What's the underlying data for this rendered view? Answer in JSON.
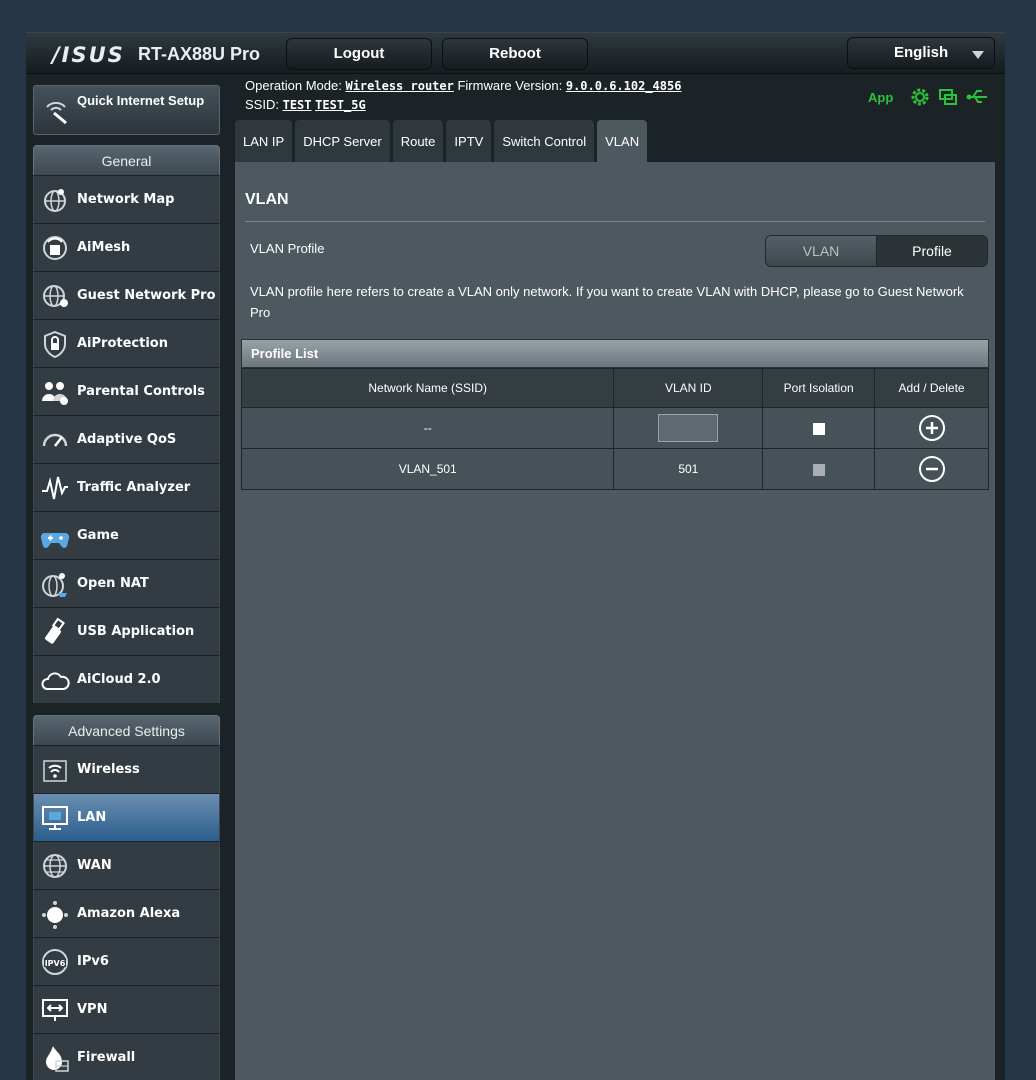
{
  "header": {
    "logo": "/ISUS",
    "model": "RT-AX88U Pro",
    "logout_label": "Logout",
    "reboot_label": "Reboot",
    "language": "English"
  },
  "info": {
    "operation_mode_label": "Operation Mode:",
    "operation_mode_value": "Wireless router",
    "firmware_label": "Firmware Version:",
    "firmware_value": "9.0.0.6.102_4856",
    "ssid_label": "SSID:",
    "ssid_1": "TEST",
    "ssid_2": "TEST_5G",
    "app_label": "App"
  },
  "sidebar": {
    "quick_setup": "Quick Internet Setup",
    "general_title": "General",
    "general_items": [
      {
        "label": "Network Map",
        "icon": "globe-map-icon"
      },
      {
        "label": "AiMesh",
        "icon": "aimesh-icon"
      },
      {
        "label": "Guest Network Pro",
        "icon": "guest-globe-icon"
      },
      {
        "label": "AiProtection",
        "icon": "shield-lock-icon"
      },
      {
        "label": "Parental Controls",
        "icon": "family-icon"
      },
      {
        "label": "Adaptive QoS",
        "icon": "speedometer-icon"
      },
      {
        "label": "Traffic Analyzer",
        "icon": "traffic-wave-icon"
      },
      {
        "label": "Game",
        "icon": "gamepad-icon"
      },
      {
        "label": "Open NAT",
        "icon": "open-nat-icon"
      },
      {
        "label": "USB Application",
        "icon": "usb-icon"
      },
      {
        "label": "AiCloud 2.0",
        "icon": "cloud-icon"
      }
    ],
    "advanced_title": "Advanced Settings",
    "advanced_items": [
      {
        "label": "Wireless",
        "icon": "wifi-icon"
      },
      {
        "label": "LAN",
        "icon": "lan-icon"
      },
      {
        "label": "WAN",
        "icon": "wan-globe-icon"
      },
      {
        "label": "Amazon Alexa",
        "icon": "alexa-icon"
      },
      {
        "label": "IPv6",
        "icon": "ipv6-icon"
      },
      {
        "label": "VPN",
        "icon": "vpn-icon"
      },
      {
        "label": "Firewall",
        "icon": "firewall-icon"
      }
    ]
  },
  "tabs": [
    "LAN IP",
    "DHCP Server",
    "Route",
    "IPTV",
    "Switch Control",
    "VLAN"
  ],
  "active_tab": "VLAN",
  "main": {
    "title": "VLAN",
    "vlan_profile_label": "VLAN Profile",
    "seg_vlan": "VLAN",
    "seg_profile": "Profile",
    "description": "VLAN profile here refers to create a VLAN only network. If you want to create VLAN with DHCP, please go to Guest Network Pro",
    "profile_list_title": "Profile List",
    "columns": [
      "Network Name (SSID)",
      "VLAN ID",
      "Port Isolation",
      "Add / Delete"
    ],
    "new_row_name": "--",
    "new_row_vlan_id": "",
    "rows": [
      {
        "name": "VLAN_501",
        "vlan_id": "501"
      }
    ]
  },
  "colors": {
    "accent_green": "#29c33a",
    "active_item_blue": "#2b5f8e"
  }
}
